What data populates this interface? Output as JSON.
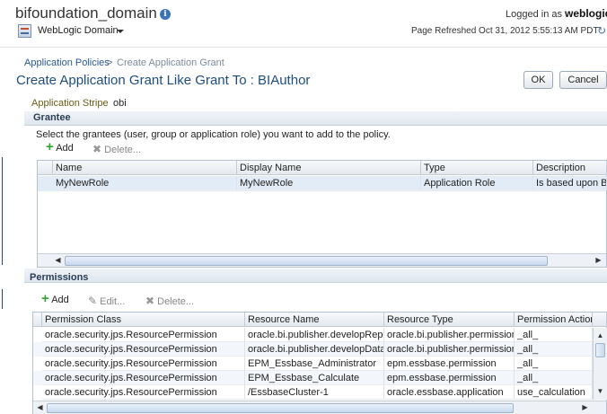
{
  "header": {
    "domain_title": "bifoundation_domain",
    "logged_in_label": "Logged in as",
    "username": "weblogic",
    "menu_label": "WebLogic Domain",
    "page_refreshed": "Page Refreshed Oct 31, 2012 5:55:13 AM PDT"
  },
  "breadcrumb": {
    "link": "Application Policies",
    "separator": ">",
    "current": "Create Application Grant"
  },
  "page_title": "Create Application Grant Like Grant To : BIAuthor",
  "buttons": {
    "ok": "OK",
    "cancel": "Cancel"
  },
  "application_stripe": {
    "label": "Application Stripe",
    "value": "obi"
  },
  "grantee": {
    "title": "Grantee",
    "description": "Select the grantees (user, group or application role) you want to add to the policy.",
    "toolbar": {
      "add": "Add",
      "delete": "Delete..."
    },
    "columns": [
      "Name",
      "Display Name",
      "Type",
      "Description"
    ],
    "rows": [
      [
        "MyNewRole",
        "MyNewRole",
        "Application Role",
        "Is based upon BIAuthor"
      ]
    ]
  },
  "permissions": {
    "title": "Permissions",
    "toolbar": {
      "add": "Add",
      "edit": "Edit...",
      "delete": "Delete..."
    },
    "columns": [
      "Permission Class",
      "Resource Name",
      "Resource Type",
      "Permission Actions"
    ],
    "rows": [
      [
        "oracle.security.jps.ResourcePermission",
        "oracle.bi.publisher.developReport",
        "oracle.bi.publisher.permission",
        "_all_"
      ],
      [
        "oracle.security.jps.ResourcePermission",
        "oracle.bi.publisher.developDataModel",
        "oracle.bi.publisher.permission",
        "_all_"
      ],
      [
        "oracle.security.jps.ResourcePermission",
        "EPM_Essbase_Administrator",
        "epm.essbase.permission",
        "_all_"
      ],
      [
        "oracle.security.jps.ResourcePermission",
        "EPM_Essbase_Calculate",
        "epm.essbase.permission",
        "_all_"
      ],
      [
        "oracle.security.jps.ResourcePermission",
        "/EssbaseCluster-1",
        "oracle.essbase.application",
        "use_calculation"
      ]
    ]
  },
  "icons": {
    "info": "info-icon",
    "domain": "weblogic-domain-icon",
    "refresh": "refresh-icon",
    "add": "plus-icon",
    "delete": "x-icon",
    "edit": "pencil-icon"
  },
  "colors": {
    "title_blue": "#1e4d80",
    "link_blue": "#28579a",
    "add_green": "#2ca52c"
  }
}
